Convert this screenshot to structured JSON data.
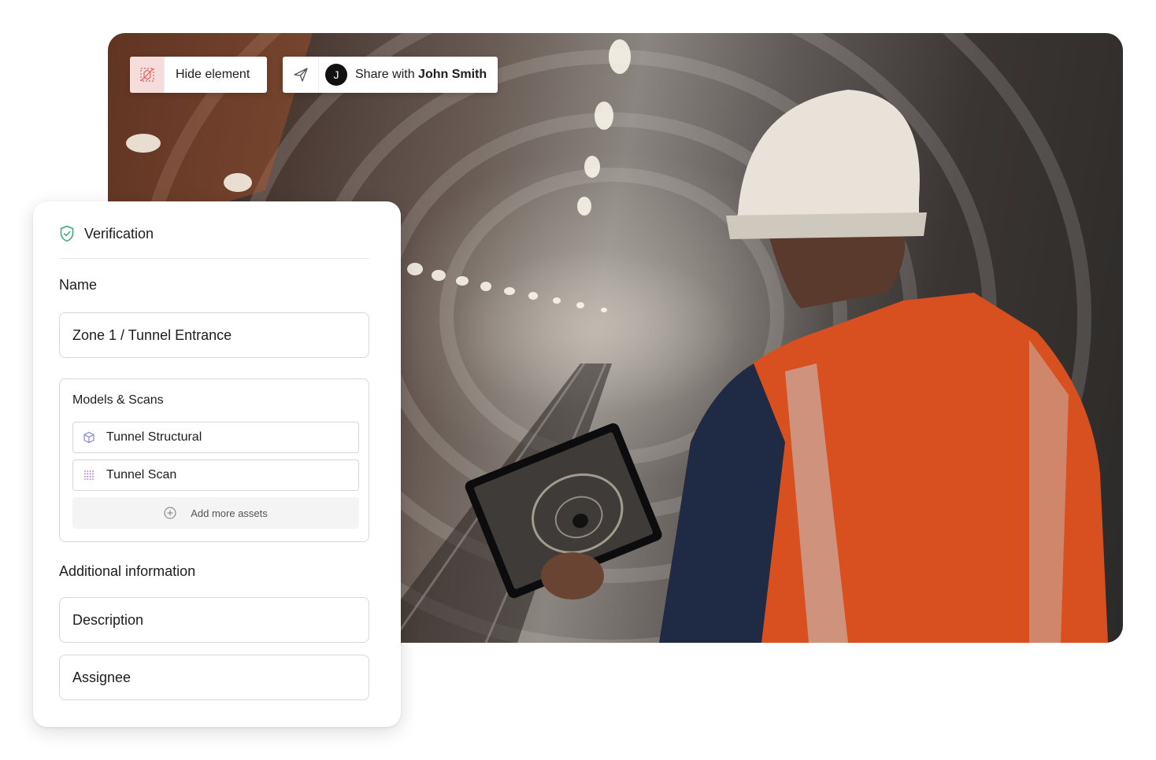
{
  "photo": {
    "description_icon": "tunnel-worker-photo"
  },
  "toolbar": {
    "hide_label": "Hide element",
    "hide_icon": "hide-element-icon",
    "send_icon": "send-icon",
    "avatar_initial": "J",
    "share_prefix": "Share with",
    "share_name": "John Smith"
  },
  "panel": {
    "title": "Verification",
    "title_icon": "shield-check-icon",
    "name_label": "Name",
    "name_value": "Zone 1 / Tunnel Entrance",
    "assets_title": "Models & Scans",
    "assets": [
      {
        "label": "Tunnel Structural",
        "icon": "cube-icon"
      },
      {
        "label": "Tunnel Scan",
        "icon": "point-cloud-icon"
      }
    ],
    "add_assets_label": "Add more assets",
    "additional_label": "Additional information",
    "description_placeholder": "Description",
    "assignee_placeholder": "Assignee"
  },
  "colors": {
    "accent_green": "#3aa76d",
    "hide_bg": "#f7dcdc",
    "hide_icon": "#e05a5a",
    "cube_icon": "#7b7fd6",
    "scan_icon": "#b06ad9"
  }
}
